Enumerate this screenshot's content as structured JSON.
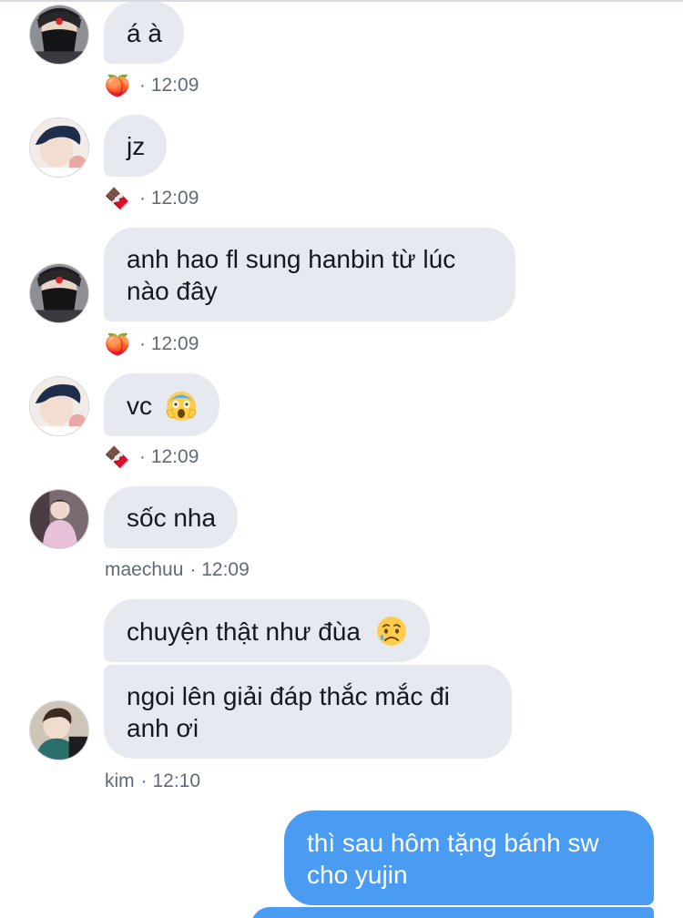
{
  "messages": [
    {
      "text": "á à",
      "meta_emoji": "🍑",
      "time": "· 12:09"
    },
    {
      "text": "jz",
      "meta_emoji": "🍫",
      "time": "· 12:09"
    },
    {
      "text": "anh hao fl sung hanbin từ lúc nào đây",
      "meta_emoji": "🍑",
      "time": "· 12:09"
    },
    {
      "text": "vc",
      "meta_emoji": "🍫",
      "time": "· 12:09"
    },
    {
      "text": "sốc nha",
      "sender": "maechuu",
      "time": "· 12:09"
    },
    {
      "text": "chuyện thật như đùa",
      "sender": "",
      "time": ""
    },
    {
      "text": "ngoi lên giải đáp thắc mắc đi anh ơi",
      "sender": "kim",
      "time": "· 12:10"
    },
    {
      "text": "thì sau hôm tặng bánh sw cho yujin",
      "outgoing": true
    }
  ],
  "icons": {
    "peach": "peach-emoji",
    "chocolate": "chocolate-emoji",
    "scream": "screaming-face-emoji",
    "sad": "sad-relieved-face-emoji"
  },
  "colors": {
    "incoming_bubble": "#e6e9ef",
    "outgoing_bubble": "#4a9cf2",
    "meta_text": "#5f6b78"
  }
}
